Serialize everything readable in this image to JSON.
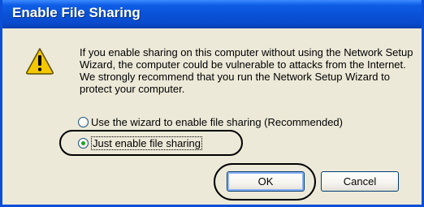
{
  "window": {
    "title": "Enable File Sharing"
  },
  "icon": "warning-icon",
  "message": "If you enable sharing on this computer without using the Network Setup Wizard, the computer could be vulnerable to attacks from the Internet. We strongly recommend that you run the Network Setup Wizard to protect your computer.",
  "options": {
    "wizard_label": "Use the wizard to enable file sharing (Recommended)",
    "wizard_selected": false,
    "just_enable_label": "Just enable file sharing",
    "just_enable_selected": true
  },
  "buttons": {
    "ok_label": "OK",
    "cancel_label": "Cancel"
  },
  "colors": {
    "titlebar": "#0a52d8",
    "dialog_background": "#ece9d8",
    "radio_selected_dot": "#21a121",
    "warning_yellow": "#f4c800"
  }
}
